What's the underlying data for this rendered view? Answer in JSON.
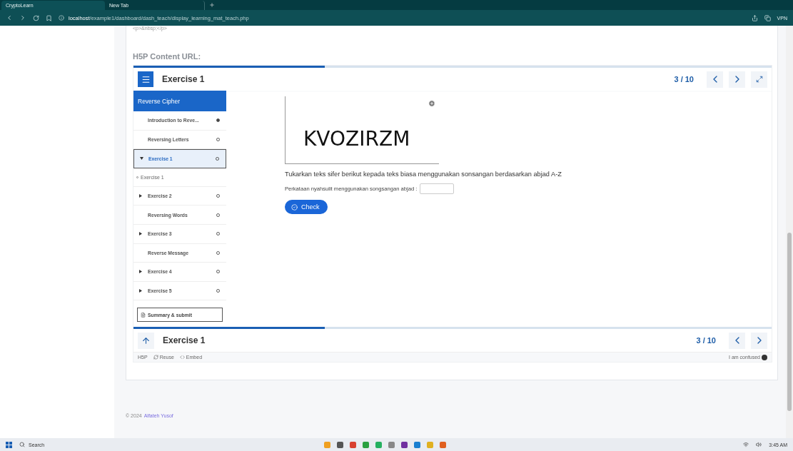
{
  "browser": {
    "tabs": [
      {
        "title": "CryptoLearn",
        "selected": true
      },
      {
        "title": "New Tab",
        "selected": false
      }
    ],
    "url_host": "localhost",
    "url_path": "/example1/dashboard/dash_teach/display_learning_mat_teach.php",
    "vpn": "VPN"
  },
  "page": {
    "cut_text": "<p>&nbsp;</p>",
    "heading": "H5P Content URL:",
    "h5p": {
      "progress": {
        "level": 0.3
      },
      "title": "Exercise 1",
      "counter": "3 / 10",
      "sidebar": {
        "chapter": "Reverse Cipher",
        "items": [
          {
            "kind": "page",
            "label": "Introduction to Reve...",
            "done": true,
            "selected": false
          },
          {
            "kind": "page",
            "label": "Reversing Letters",
            "done": false,
            "selected": false
          },
          {
            "kind": "exercise",
            "label": "Exercise 1",
            "done": false,
            "selected": true,
            "expanded": true,
            "children": [
              {
                "label": "Exercise 1"
              }
            ]
          },
          {
            "kind": "exercise",
            "label": "Exercise 2",
            "done": false,
            "selected": false,
            "expanded": false
          },
          {
            "kind": "page",
            "label": "Reversing Words",
            "done": false,
            "selected": false
          },
          {
            "kind": "exercise",
            "label": "Exercise 3",
            "done": false,
            "selected": false,
            "expanded": false
          },
          {
            "kind": "page",
            "label": "Reverse Message",
            "done": false,
            "selected": false
          },
          {
            "kind": "exercise",
            "label": "Exercise 4",
            "done": false,
            "selected": false,
            "expanded": false
          },
          {
            "kind": "exercise",
            "label": "Exercise 5",
            "done": false,
            "selected": false,
            "expanded": false
          }
        ],
        "summary": "Summary & submit"
      },
      "content": {
        "cipher": "KVOZIRZM",
        "instruction": "Tukarkan teks sifer berikut kepada teks biasa menggunakan sonsangan berdasarkan abjad A-Z",
        "prompt": "Perkataan nyahsulit menggunakan songsangan abjad :",
        "check": "Check"
      },
      "footer": {
        "progress": {
          "level": 0.3
        },
        "title": "Exercise 1",
        "counter": "3 / 10"
      },
      "actions": {
        "logo": "H5P",
        "reuse": "Reuse",
        "embed": "Embed",
        "confused": "I am confused"
      }
    },
    "copyright": "© 2024",
    "author": "Alfateh Yusof"
  },
  "taskbar": {
    "search": "Search",
    "time": "3:45 AM"
  }
}
